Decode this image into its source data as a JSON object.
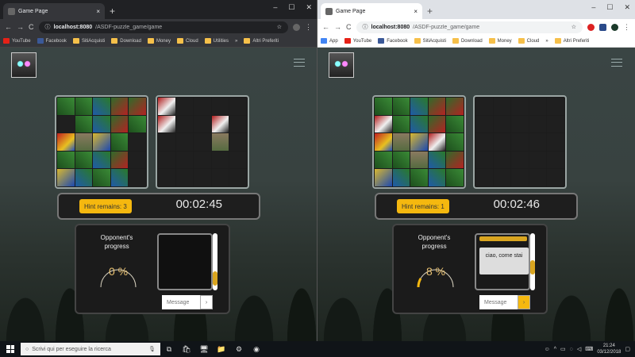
{
  "browsers": [
    {
      "tab_title": "Game Page",
      "tab_close": "×",
      "new_tab": "+",
      "window_controls": [
        "–",
        "☐",
        "✕"
      ],
      "url_host": "localhost:8080",
      "url_path": "/ASDF-puzzle_game/game",
      "nav": {
        "back": "←",
        "forward": "→",
        "reload": "C",
        "info": "ⓘ",
        "star": "☆",
        "menu": "⋮"
      },
      "bookmarks": [
        "YouTube",
        "Facebook",
        "SitiAcquisti",
        "Download",
        "Money",
        "Cloud",
        "Utilities"
      ],
      "bookmarks_more": "»",
      "bookmarks_other": "Altri Preferiti",
      "hint_label": "Hint remains: 3",
      "timer": "00:02:45",
      "opponent_label": "Opponent's progress",
      "progress_text": "0 %",
      "progress_value": 0,
      "chat_messages": [],
      "message_placeholder": "Message",
      "send_label": "›"
    },
    {
      "tab_title": "Game Page",
      "tab_close": "×",
      "new_tab": "+",
      "window_controls": [
        "–",
        "☐",
        "✕"
      ],
      "url_host": "localhost:8080",
      "url_path": "/ASDF-puzzle_game/game",
      "nav": {
        "back": "←",
        "forward": "→",
        "reload": "C",
        "info": "ⓘ",
        "star": "☆",
        "menu": "⋮"
      },
      "bookmarks": [
        "App",
        "YouTube",
        "Facebook",
        "SitiAcquisti",
        "Download",
        "Money",
        "Cloud"
      ],
      "bookmarks_more": "»",
      "bookmarks_other": "Altri Preferiti",
      "hint_label": "Hint remains: 1",
      "timer": "00:02:46",
      "opponent_label": "Opponent's progress",
      "progress_text": "8 %",
      "progress_value": 8,
      "chat_messages": [
        "ciao, come stai"
      ],
      "message_placeholder": "Message",
      "send_label": "›"
    }
  ],
  "taskbar": {
    "search_placeholder": "Scrivi qui per eseguire la ricerca",
    "time": "21:24",
    "date": "03/12/2018"
  },
  "colors": {
    "accent": "#f5b80f",
    "timer_text": "#e8e8e8",
    "gauge": "#e8c070"
  }
}
